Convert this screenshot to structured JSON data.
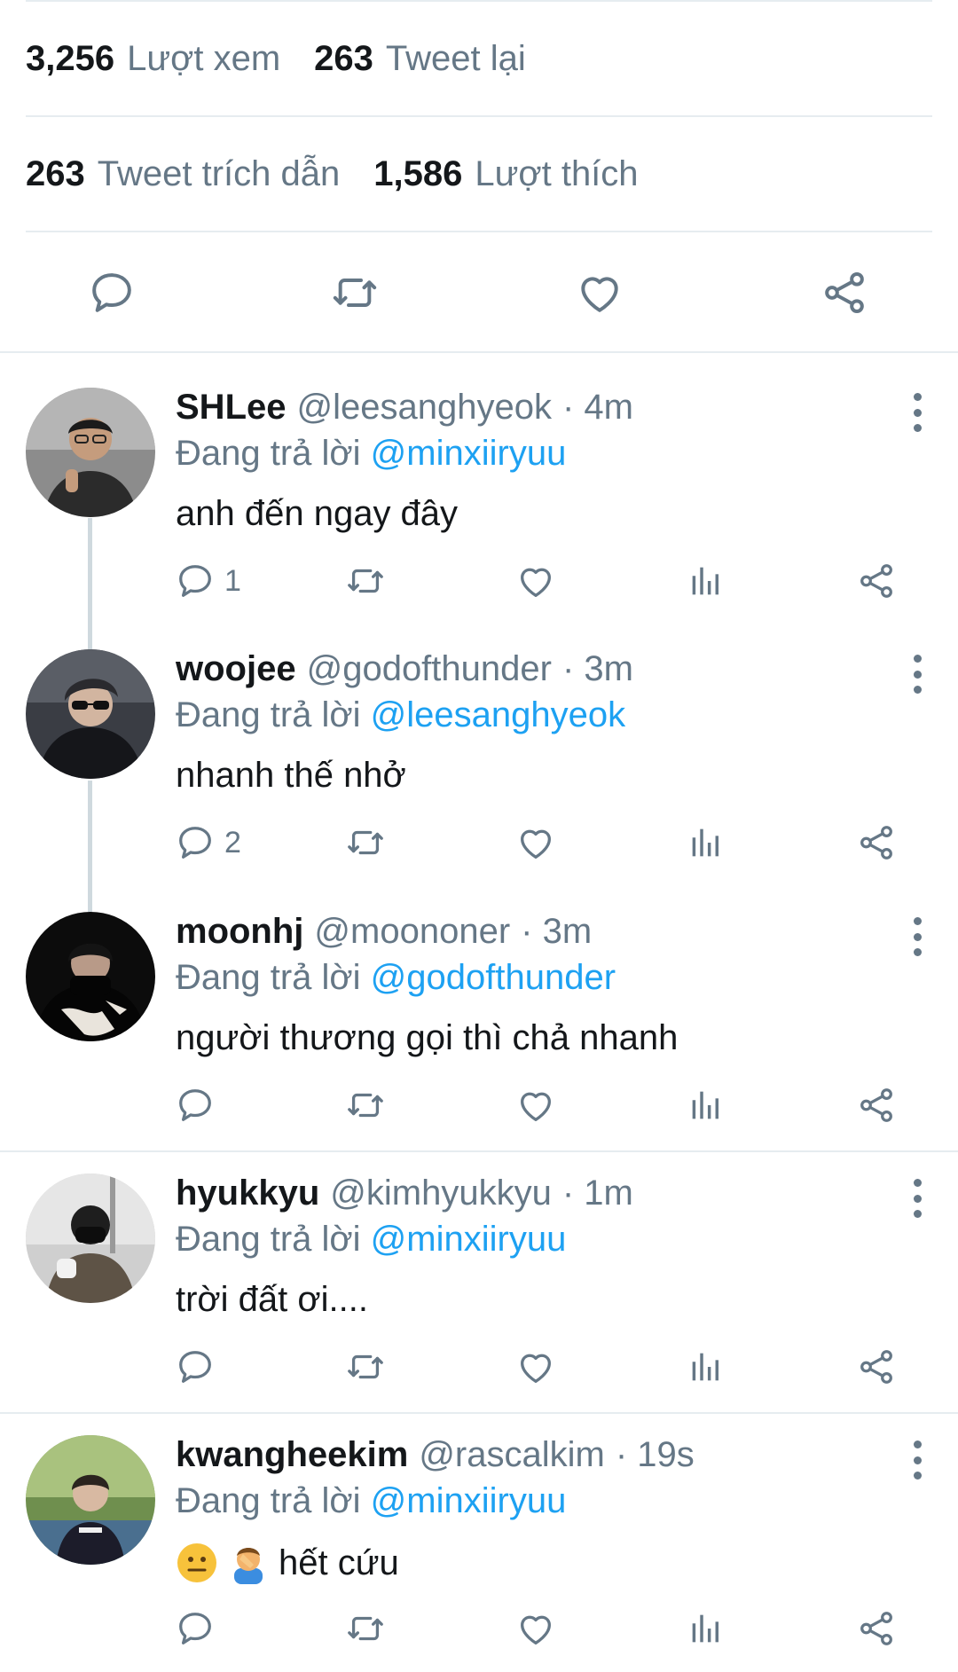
{
  "stats": {
    "views_count": "3,256",
    "views_label": "Lượt xem",
    "retweets_count": "263",
    "retweets_label": "Tweet lại",
    "quotes_count": "263",
    "quotes_label": "Tweet trích dẫn",
    "likes_count": "1,586",
    "likes_label": "Lượt thích"
  },
  "main_actions": [
    "reply-icon",
    "retweet-icon",
    "like-icon",
    "share-icon"
  ],
  "replies": [
    {
      "name": "SHLee",
      "handle": "@leesanghyeok",
      "time": "· 4m",
      "reply_label": "Đang trả lời",
      "reply_to": "@minxiiryuu",
      "text": "anh đến ngay đây",
      "reply_count": "1"
    },
    {
      "name": "woojee",
      "handle": "@godofthunder",
      "time": "· 3m",
      "reply_label": "Đang trả lời",
      "reply_to": "@leesanghyeok",
      "text": "nhanh thế nhở",
      "reply_count": "2"
    },
    {
      "name": "moonhj",
      "handle": "@moononer",
      "time": "· 3m",
      "reply_label": "Đang trả lời",
      "reply_to": "@godofthunder",
      "text": "người thương gọi thì chả nhanh",
      "reply_count": ""
    },
    {
      "name": "hyukkyu",
      "handle": "@kimhyukkyu",
      "time": "· 1m",
      "reply_label": "Đang trả lời",
      "reply_to": "@minxiiryuu",
      "text": "trời đất ơi....",
      "reply_count": ""
    },
    {
      "name": "kwangheekim",
      "handle": "@rascalkim",
      "time": "· 19s",
      "reply_label": "Đang trả lời",
      "reply_to": "@minxiiryuu",
      "text": "hết cứu",
      "emojis": [
        "slightly-confused-face-emoji",
        "person-facepalming-emoji"
      ],
      "reply_count": ""
    }
  ],
  "colors": {
    "accent": "#1da1f2",
    "muted": "#657786",
    "text": "#14171a",
    "divider": "#e6ecf0"
  }
}
